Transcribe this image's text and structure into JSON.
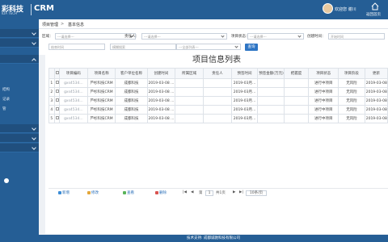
{
  "header": {
    "logo_text": "彩科技",
    "logo_sub": "IDA TECH",
    "app_name": "CRM",
    "user_greeting": "欢迎您",
    "user_name": "谢川",
    "home_label": "返回首页"
  },
  "sidebar": {
    "items": [
      {
        "label": "",
        "type": "group",
        "chevron": "down"
      },
      {
        "label": "",
        "type": "group",
        "chevron": "down"
      },
      {
        "label": "",
        "type": "group",
        "chevron": "up"
      },
      {
        "label": "",
        "type": "sub"
      },
      {
        "label": "",
        "type": "sub"
      },
      {
        "label": "结构",
        "type": "sub"
      },
      {
        "label": "记录",
        "type": "sub"
      },
      {
        "label": "管",
        "type": "sub"
      },
      {
        "label": "",
        "type": "sub"
      },
      {
        "label": "",
        "type": "group",
        "chevron": "down"
      },
      {
        "label": "",
        "type": "group",
        "chevron": "down"
      },
      {
        "label": "",
        "type": "group",
        "chevron": "down"
      }
    ]
  },
  "breadcrumb": {
    "root": "项目管理",
    "separator": ">",
    "current": "基本信息"
  },
  "filters": {
    "row1": [
      {
        "label": "区域：",
        "value": "---请选择---"
      },
      {
        "label": "责任人：",
        "value": "---请选择---"
      },
      {
        "label": "项目状态：",
        "value": "---请选择---"
      },
      {
        "label": "创建时间：",
        "placeholder": "开始时间"
      }
    ],
    "row2": [
      {
        "placeholder": "结束时间"
      },
      {
        "placeholder": "模糊搜索"
      },
      {
        "value": "---全部列表---"
      }
    ],
    "query_label": "查询"
  },
  "table": {
    "title": "项目信息列表",
    "columns": [
      "",
      "项目编码",
      "项目名称",
      "客户单位名称",
      "创建时间",
      "所属区域",
      "责任人",
      "预签时间",
      "预签金额(万元)",
      "把握度",
      "项目状态",
      "项目阶段",
      "更新"
    ],
    "rows": [
      {
        "no": "1",
        "code": "gxs4534...",
        "name": "芦杉科技CRM",
        "client": "成都科技",
        "created": "2019-03-08 ...",
        "region": "",
        "owner": "",
        "sign_date": "2019-03月...",
        "amount": "",
        "confidence": "",
        "status": "进行中项目",
        "stage": "无风险",
        "update": "2019-03-08"
      },
      {
        "no": "2",
        "code": "gxs4534...",
        "name": "芦杉科技CRM",
        "client": "成都科技",
        "created": "2019-03-08 ...",
        "region": "",
        "owner": "",
        "sign_date": "2019-03月...",
        "amount": "",
        "confidence": "",
        "status": "进行中项目",
        "stage": "无风险",
        "update": "2019-03-08"
      },
      {
        "no": "3",
        "code": "gxs4534...",
        "name": "芦杉科技CRM",
        "client": "成都科技",
        "created": "2019-03-08 ...",
        "region": "",
        "owner": "",
        "sign_date": "2019-03月...",
        "amount": "",
        "confidence": "",
        "status": "进行中项目",
        "stage": "无风险",
        "update": "2019-03-08"
      },
      {
        "no": "4",
        "code": "gxs4534...",
        "name": "芦杉科技CRM",
        "client": "成都科技",
        "created": "2019-03-08 ...",
        "region": "",
        "owner": "",
        "sign_date": "2019-03月...",
        "amount": "",
        "confidence": "",
        "status": "进行中项目",
        "stage": "无风险",
        "update": "2019-03-08"
      },
      {
        "no": "5",
        "code": "gxs4534...",
        "name": "芦杉科技CRM",
        "client": "成都科技",
        "created": "2019-03-08 ...",
        "region": "",
        "owner": "",
        "sign_date": "2019-03月...",
        "amount": "",
        "confidence": "",
        "status": "进行中项目",
        "stage": "无风险",
        "update": "2019-03-08"
      }
    ]
  },
  "toolbar": {
    "add": "新增",
    "edit": "修改",
    "view": "查看",
    "delete": "删除",
    "page_prefix": "第",
    "page_value": "1",
    "page_suffix": "共1页",
    "page_size": "10条/页"
  },
  "footer": {
    "text": "技术支持: 成都诚驰科技有限公司"
  },
  "colors": {
    "brand": "#255e95",
    "accent": "#2e75c4"
  }
}
